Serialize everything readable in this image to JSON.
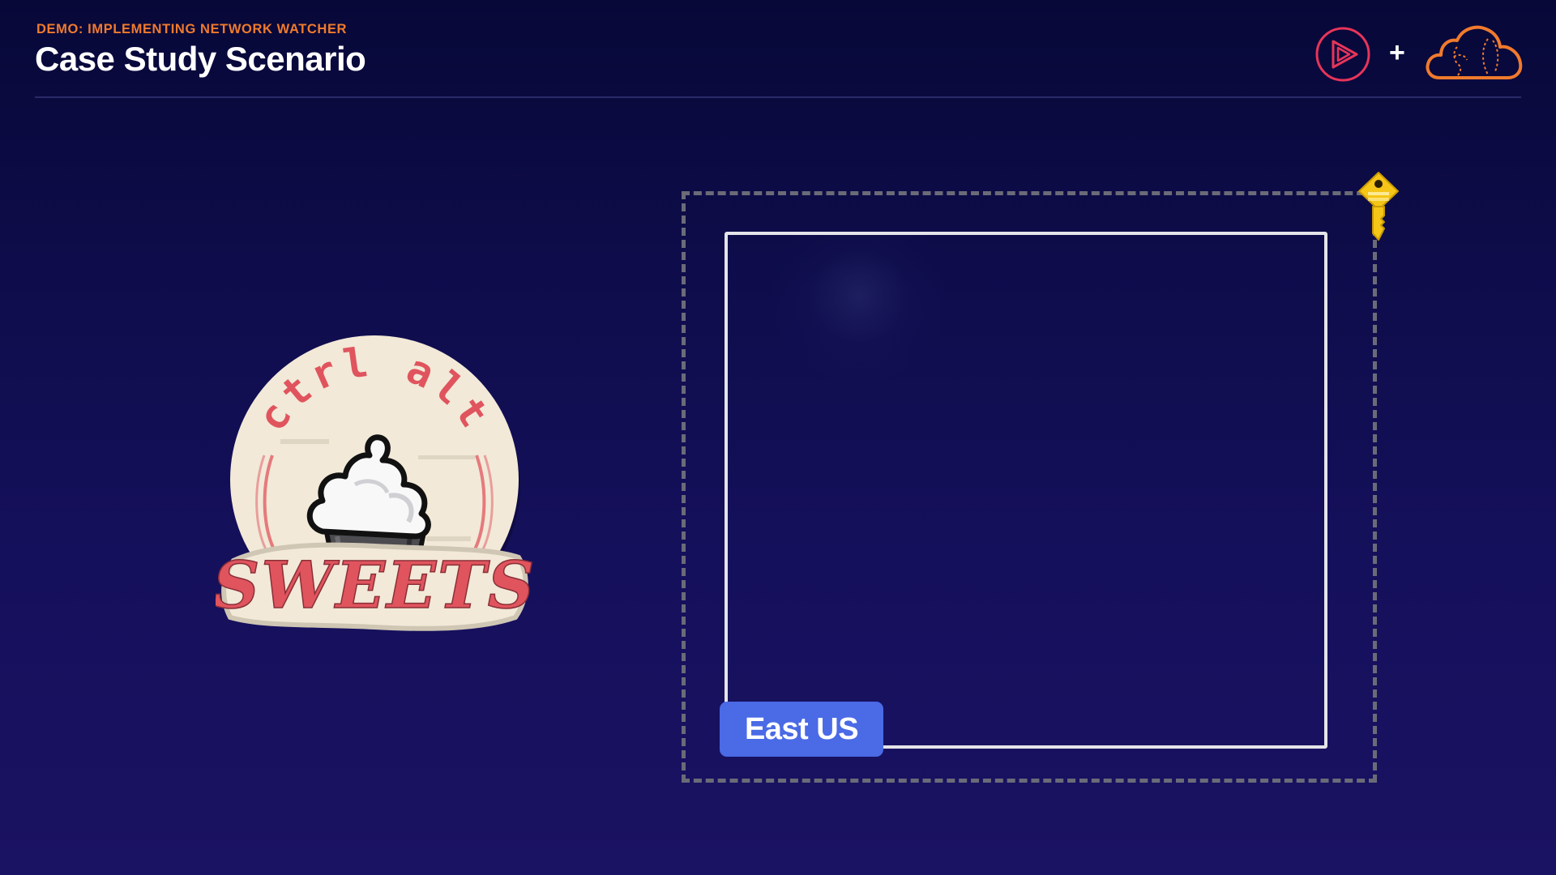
{
  "header": {
    "subtitle": "DEMO: IMPLEMENTING NETWORK WATCHER",
    "title": "Case Study Scenario",
    "plus": "+"
  },
  "logos": {
    "left_icon": "pluralsight-play-icon",
    "right_icon": "cloud-icon",
    "accent_color": "#f07a2d",
    "play_color": "#e8345a"
  },
  "company_logo": {
    "line1": "ctrl alt",
    "line2": "SWEETS",
    "icon": "cupcake-icon",
    "text_color": "#e0545e",
    "badge_color": "#f2e9d8"
  },
  "diagram": {
    "region_label": "East US",
    "region_color": "#4a6ae6",
    "key_icon": "key-icon",
    "key_color": "#f5c518"
  }
}
